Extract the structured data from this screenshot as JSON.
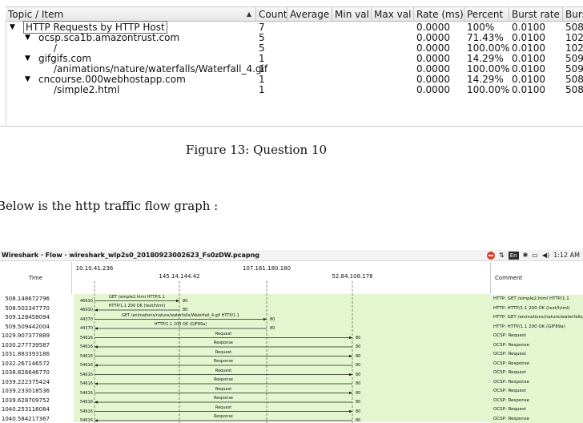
{
  "stats_table": {
    "columns": [
      "Topic / Item",
      "Count",
      "Average",
      "Min val",
      "Max val",
      "Rate (ms)",
      "Percent",
      "Burst rate",
      "Burs"
    ],
    "rows": [
      {
        "level": 0,
        "expand": true,
        "topic": "HTTP Requests by HTTP Host",
        "count": "7",
        "rate": "0.0000",
        "percent": "100%",
        "burst": "0.0100",
        "burs": "508"
      },
      {
        "level": 1,
        "expand": true,
        "topic": "ocsp.sca1b.amazontrust.com",
        "count": "5",
        "rate": "0.0000",
        "percent": "71.43%",
        "burst": "0.0100",
        "burs": "102"
      },
      {
        "level": 2,
        "expand": false,
        "topic": "/",
        "count": "5",
        "rate": "0.0000",
        "percent": "100.00%",
        "burst": "0.0100",
        "burs": "102"
      },
      {
        "level": 1,
        "expand": true,
        "topic": "gifgifs.com",
        "count": "1",
        "rate": "0.0000",
        "percent": "14.29%",
        "burst": "0.0100",
        "burs": "509"
      },
      {
        "level": 2,
        "expand": false,
        "topic": "/animations/nature/waterfalls/Waterfall_4.gif",
        "count": "1",
        "rate": "0.0000",
        "percent": "100.00%",
        "burst": "0.0100",
        "burs": "509"
      },
      {
        "level": 1,
        "expand": true,
        "topic": "cncourse.000webhostapp.com",
        "count": "1",
        "rate": "0.0000",
        "percent": "14.29%",
        "burst": "0.0100",
        "burs": "508"
      },
      {
        "level": 2,
        "expand": false,
        "topic": "/simple2.html",
        "count": "1",
        "rate": "0.0000",
        "percent": "100.00%",
        "burst": "0.0100",
        "burs": "508"
      }
    ]
  },
  "caption": "Figure 13: Question 10",
  "body_text": "Below is the http traffic flow graph :",
  "flow": {
    "window_title": "Wireshark · Flow · wireshark_wlp2s0_20180923002623_Fs0zDW.pcapng",
    "tray": {
      "lang": "En",
      "clock": "1:12 AM"
    },
    "time_header": "Time",
    "comment_header": "Comment",
    "hosts": [
      "10.10.41.236",
      "145.14.144.42",
      "107.161.180.180",
      "52.84.108.178"
    ],
    "rows": [
      {
        "time": "508.148672796",
        "from": 0,
        "to": 1,
        "sport": "46630",
        "dport": "80",
        "label": "GET /simple2.html HTTP/1.1",
        "comment": "HTTP: GET /simple2.html HTTP/1.1"
      },
      {
        "time": "508.502347770",
        "from": 1,
        "to": 0,
        "sport": "46630",
        "dport": "80",
        "label": "HTTP/1.1 200 OK  (text/html)",
        "comment": "HTTP: HTTP/1.1 200 OK  (text/html)"
      },
      {
        "time": "509.128458094",
        "from": 0,
        "to": 2,
        "sport": "44370",
        "dport": "80",
        "label": "GET /animations/nature/waterfalls/Waterfall_4.gif HTTP/1.1",
        "comment": "HTTP: GET /animations/nature/waterfalls/..."
      },
      {
        "time": "509.509442004",
        "from": 2,
        "to": 0,
        "sport": "44370",
        "dport": "80",
        "label": "HTTP/1.1 200 OK  (GIF89a)",
        "comment": "HTTP: HTTP/1.1 200 OK  (GIF89a)"
      },
      {
        "time": "1029.907377889",
        "from": 0,
        "to": 3,
        "sport": "54616",
        "dport": "80",
        "label": "Request",
        "comment": "OCSP: Request"
      },
      {
        "time": "1030.277739587",
        "from": 3,
        "to": 0,
        "sport": "54616",
        "dport": "80",
        "label": "Response",
        "comment": "OCSP: Response"
      },
      {
        "time": "1031.883393186",
        "from": 0,
        "to": 3,
        "sport": "54616",
        "dport": "80",
        "label": "Request",
        "comment": "OCSP: Request"
      },
      {
        "time": "1032.267146572",
        "from": 3,
        "to": 0,
        "sport": "54616",
        "dport": "80",
        "label": "Response",
        "comment": "OCSP: Response"
      },
      {
        "time": "1038.826646770",
        "from": 0,
        "to": 3,
        "sport": "54616",
        "dport": "80",
        "label": "Request",
        "comment": "OCSP: Request"
      },
      {
        "time": "1039.222375424",
        "from": 3,
        "to": 0,
        "sport": "54616",
        "dport": "80",
        "label": "Response",
        "comment": "OCSP: Response"
      },
      {
        "time": "1039.233018536",
        "from": 0,
        "to": 3,
        "sport": "54616",
        "dport": "80",
        "label": "Request",
        "comment": "OCSP: Request"
      },
      {
        "time": "1039.628709752",
        "from": 3,
        "to": 0,
        "sport": "54616",
        "dport": "80",
        "label": "Response",
        "comment": "OCSP: Response"
      },
      {
        "time": "1040.253116084",
        "from": 0,
        "to": 3,
        "sport": "54616",
        "dport": "80",
        "label": "Request",
        "comment": "OCSP: Request"
      },
      {
        "time": "1040.584217367",
        "from": 3,
        "to": 0,
        "sport": "54616",
        "dport": "80",
        "label": "Response",
        "comment": "OCSP: Response"
      }
    ]
  }
}
